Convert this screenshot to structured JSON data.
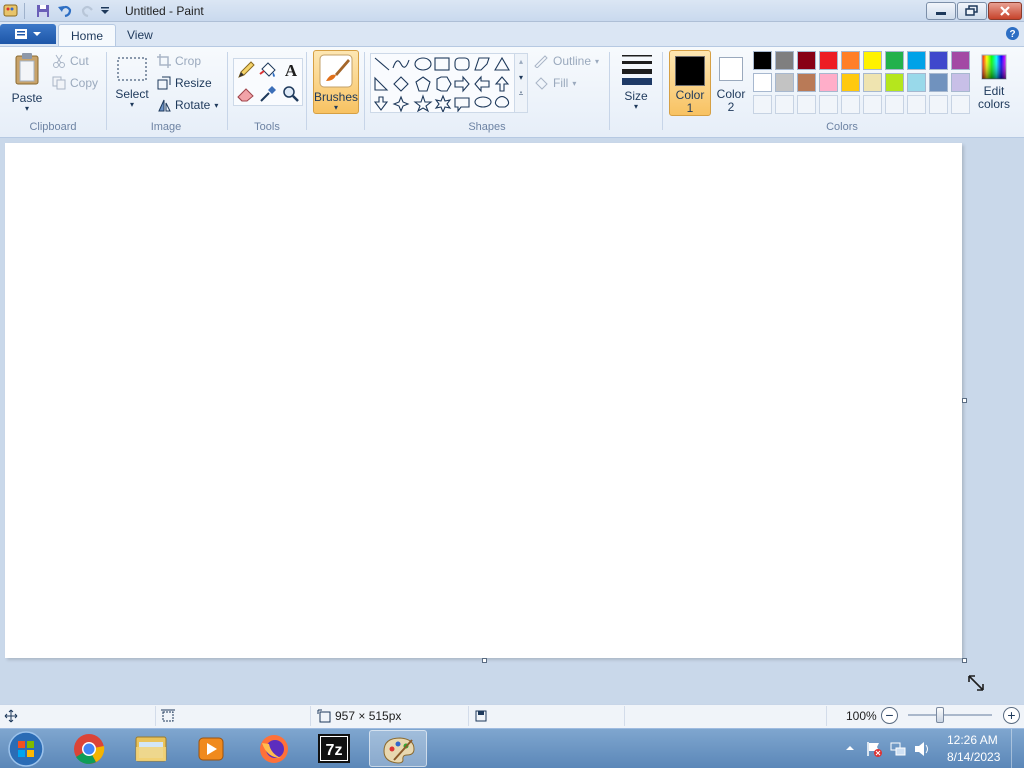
{
  "window": {
    "title": "Untitled - Paint"
  },
  "tabs": [
    {
      "label": "Home",
      "active": true
    },
    {
      "label": "View",
      "active": false
    }
  ],
  "ribbon": {
    "clipboard": {
      "group": "Clipboard",
      "paste": "Paste",
      "cut": "Cut",
      "copy": "Copy"
    },
    "image": {
      "group": "Image",
      "select": "Select",
      "crop": "Crop",
      "resize": "Resize",
      "rotate": "Rotate"
    },
    "tools": {
      "group": "Tools"
    },
    "brushes": {
      "label": "Brushes"
    },
    "shapes": {
      "group": "Shapes",
      "outline": "Outline",
      "fill": "Fill"
    },
    "size": {
      "label": "Size"
    },
    "colors": {
      "group": "Colors",
      "color1": {
        "line1": "Color",
        "line2": "1",
        "value": "#000000"
      },
      "color2": {
        "line1": "Color",
        "line2": "2",
        "value": "#ffffff"
      },
      "edit": {
        "line1": "Edit",
        "line2": "colors"
      },
      "palette_row1": [
        "#000000",
        "#7f7f7f",
        "#880015",
        "#ed1c24",
        "#ff7f27",
        "#fff200",
        "#22b14c",
        "#00a2e8",
        "#3f48cc",
        "#a349a4"
      ],
      "palette_row2": [
        "#ffffff",
        "#c3c3c3",
        "#b97a57",
        "#ffaec9",
        "#ffc90e",
        "#efe4b0",
        "#b5e61d",
        "#99d9ea",
        "#7092be",
        "#c8bfe7"
      ]
    }
  },
  "status": {
    "canvas_size": "957 × 515px",
    "zoom": "100%",
    "zoom_fraction": 0.38
  },
  "taskbar": {
    "time": "12:26 AM",
    "date": "8/14/2023"
  }
}
